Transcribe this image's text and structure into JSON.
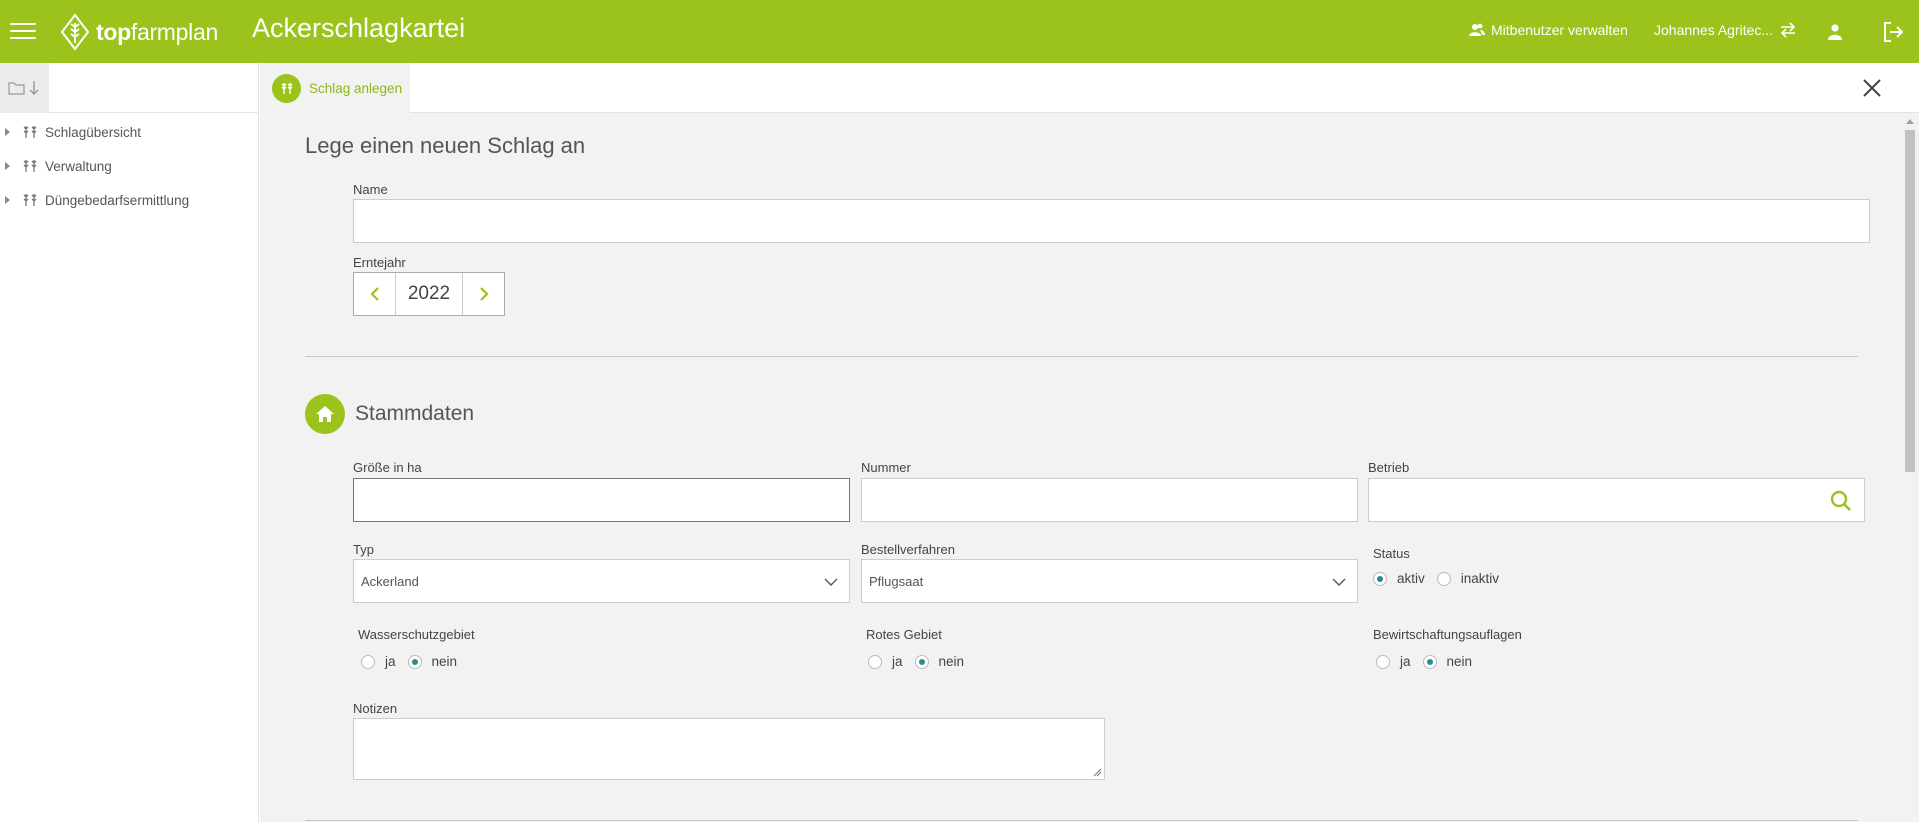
{
  "header": {
    "logo_bold": "top",
    "logo_light": "farmplan",
    "app_title": "Ackerschlagkartei",
    "co_users_label": "Mitbenutzer verwalten",
    "account_name": "Johannes Agritec...",
    "bar_color": "#9bc31c"
  },
  "sidebar": {
    "items": [
      {
        "label": "Schlagübersicht"
      },
      {
        "label": "Verwaltung"
      },
      {
        "label": "Düngebedarfsermittlung"
      }
    ]
  },
  "tab": {
    "label": "Schlag anlegen"
  },
  "form": {
    "title": "Lege einen neuen Schlag an",
    "name_label": "Name",
    "name_value": "",
    "harvest_year_label": "Erntejahr",
    "harvest_year_value": "2022",
    "section_title": "Stammdaten",
    "size_label": "Größe in ha",
    "size_value": "",
    "number_label": "Nummer",
    "number_value": "",
    "farm_label": "Betrieb",
    "farm_value": "",
    "type_label": "Typ",
    "type_value": "Ackerland",
    "tillage_label": "Bestellverfahren",
    "tillage_value": "Pflugsaat",
    "status_label": "Status",
    "status_active": "aktiv",
    "status_inactive": "inaktiv",
    "status_selected": "aktiv",
    "water_protection_label": "Wasserschutzgebiet",
    "red_area_label": "Rotes Gebiet",
    "management_label": "Bewirtschaftungsauflagen",
    "yes": "ja",
    "no": "nein",
    "water_protection_selected": "nein",
    "red_area_selected": "nein",
    "management_selected": "nein",
    "notes_label": "Notizen",
    "notes_value": ""
  }
}
